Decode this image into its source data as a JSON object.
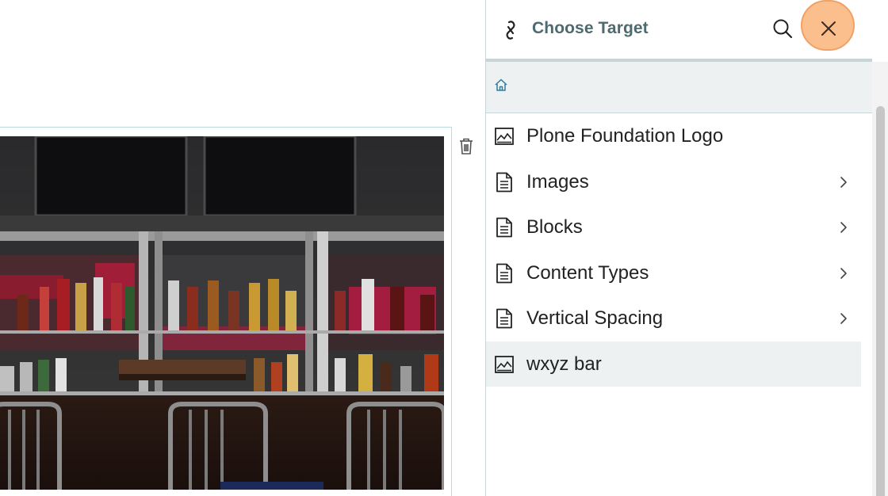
{
  "sidebar": {
    "title": "Choose Target",
    "items": [
      {
        "label": "Plone Foundation Logo",
        "icon": "image-icon",
        "has_children": false
      },
      {
        "label": "Images",
        "icon": "document-icon",
        "has_children": true
      },
      {
        "label": "Blocks",
        "icon": "document-icon",
        "has_children": true
      },
      {
        "label": "Content Types",
        "icon": "document-icon",
        "has_children": true
      },
      {
        "label": "Vertical Spacing",
        "icon": "document-icon",
        "has_children": true
      },
      {
        "label": "wxyz bar",
        "icon": "image-icon",
        "has_children": false,
        "selected": true
      }
    ]
  },
  "colors": {
    "title": "#4d6b6f",
    "divider": "#c7d5d8",
    "breadcrumb_bg": "#edf1f2",
    "close_highlight": "#fbbf8d",
    "home_icon": "#2f7c9b"
  }
}
